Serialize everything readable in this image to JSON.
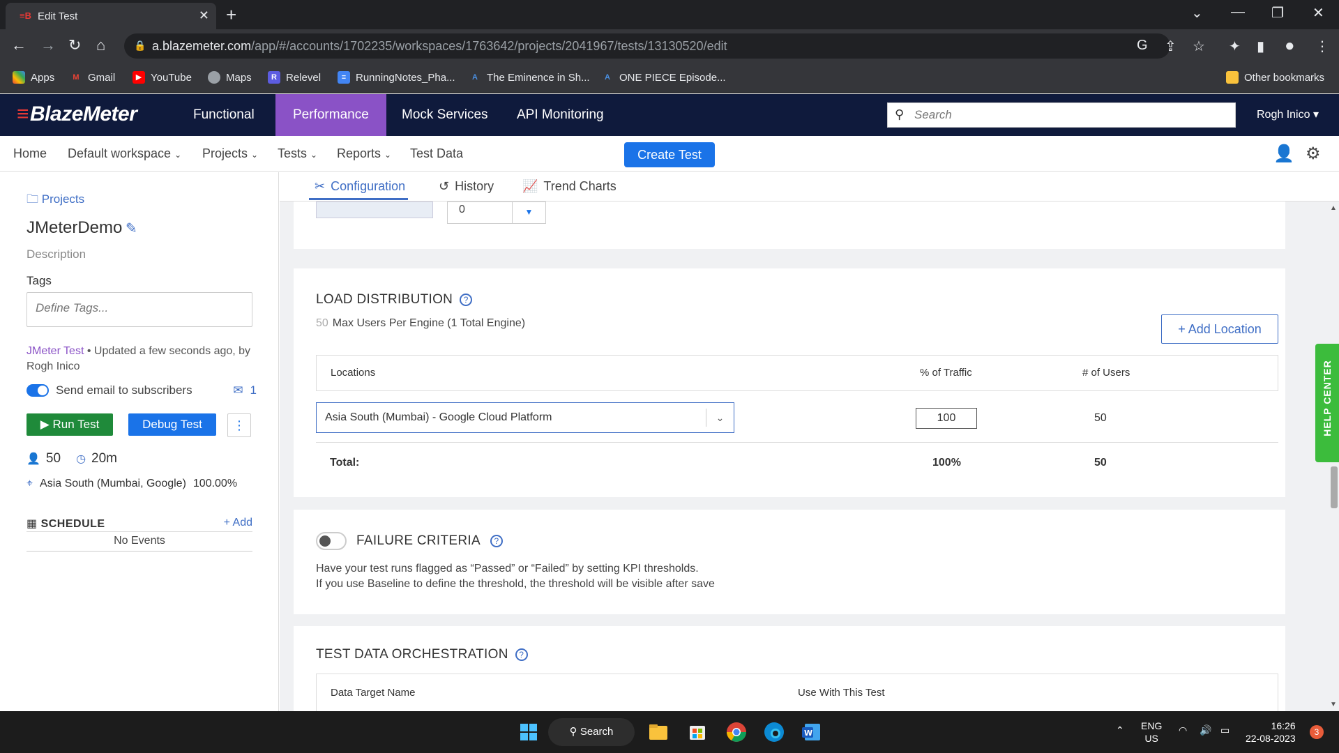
{
  "browser": {
    "tab_title": "Edit Test",
    "url_host": "a.blazemeter.com",
    "url_path": "/app/#/accounts/1702235/workspaces/1763642/projects/2041967/tests/13130520/edit"
  },
  "bookmarks": [
    {
      "label": "Apps"
    },
    {
      "label": "Gmail"
    },
    {
      "label": "YouTube"
    },
    {
      "label": "Maps"
    },
    {
      "label": "Relevel"
    },
    {
      "label": "RunningNotes_Pha..."
    },
    {
      "label": "The Eminence in Sh..."
    },
    {
      "label": "ONE PIECE Episode..."
    }
  ],
  "other_bookmarks": "Other bookmarks",
  "header": {
    "logo": "BlazeMeter",
    "nav": [
      "Functional",
      "Performance",
      "Mock Services",
      "API Monitoring"
    ],
    "search_placeholder": "Search",
    "user": "Rogh Inico ▾"
  },
  "subnav": {
    "home": "Home",
    "workspace": "Default workspace",
    "projects": "Projects",
    "tests": "Tests",
    "reports": "Reports",
    "test_data": "Test Data",
    "create_test": "Create Test"
  },
  "left": {
    "projects_link": "Projects",
    "title": "JMeterDemo",
    "description": "Description",
    "tags_label": "Tags",
    "tags_placeholder": "Define Tags...",
    "test_type": "JMeter Test",
    "updated": "Updated a few seconds ago, by Rogh Inico",
    "send_email": "Send email to subscribers",
    "subscriber_count": "1",
    "run_test": "Run Test",
    "debug_test": "Debug Test",
    "users": "50",
    "duration": "20m",
    "location": "Asia South (Mumbai, Google)",
    "location_pct": "100.00%",
    "schedule": "SCHEDULE",
    "add": "+ Add",
    "no_events": "No Events"
  },
  "tabs": [
    "Configuration",
    "History",
    "Trend Charts"
  ],
  "top_card": {
    "ramp_value": "0"
  },
  "load_distribution": {
    "title": "LOAD DISTRIBUTION",
    "max_users": "50",
    "max_users_text": "Max Users Per Engine (1 Total Engine)",
    "add_location": "Add Location",
    "col_locations": "Locations",
    "col_traffic": "% of Traffic",
    "col_users": "# of Users",
    "row_location": "Asia South (Mumbai) - Google Cloud Platform",
    "row_traffic": "100",
    "row_users": "50",
    "total_label": "Total:",
    "total_traffic": "100%",
    "total_users": "50"
  },
  "failure_criteria": {
    "title": "FAILURE CRITERIA",
    "line1": "Have your test runs flagged as “Passed” or “Failed” by setting KPI thresholds.",
    "line2": "If you use Baseline to define the threshold, the threshold will be visible after save"
  },
  "test_data_orchestration": {
    "title": "TEST DATA ORCHESTRATION",
    "col_name": "Data Target Name",
    "col_use": "Use With This Test"
  },
  "help_center": "HELP CENTER",
  "taskbar": {
    "search": "Search",
    "lang1": "ENG",
    "lang2": "US",
    "time": "16:26",
    "date": "22-08-2023",
    "notif": "3"
  }
}
